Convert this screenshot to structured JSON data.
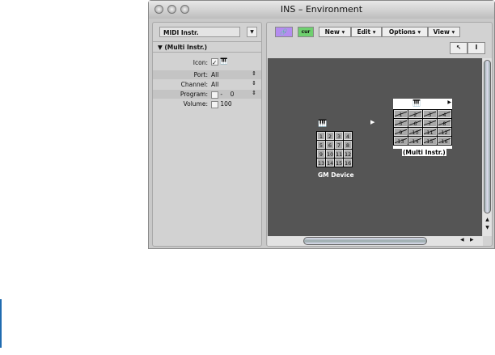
{
  "window": {
    "title": "INS – Environment"
  },
  "left": {
    "layer_select": "MIDI Instr.",
    "group": "▼ (Multi Instr.)",
    "params": [
      {
        "label": "Icon:",
        "value": ""
      },
      {
        "label": "Port:",
        "value": "All"
      },
      {
        "label": "Channel:",
        "value": "All"
      },
      {
        "label": "Program:",
        "value": "-    0"
      },
      {
        "label": "Volume:",
        "value": "100"
      }
    ]
  },
  "toolbar": {
    "new": "New ▾",
    "edit": "Edit ▾",
    "options": "Options ▾",
    "view": "View ▾",
    "link_icon": "link-icon",
    "cur_icon": "cur"
  },
  "canvas": {
    "gm_device": {
      "name": "GM Device",
      "channels": [
        "1",
        "2",
        "3",
        "4",
        "5",
        "6",
        "7",
        "8",
        "9",
        "10",
        "11",
        "12",
        "13",
        "14",
        "15",
        "16"
      ]
    },
    "multi": {
      "name": "(Multi Instr.)",
      "channels": [
        "1",
        "2",
        "3",
        "4",
        "5",
        "6",
        "7",
        "8",
        "9",
        "10",
        "11",
        "12",
        "13",
        "14",
        "15",
        "16"
      ]
    }
  },
  "colors": {
    "canvas": "#555555",
    "link_button": "#b48cf0",
    "cur_button": "#6fd06f"
  }
}
